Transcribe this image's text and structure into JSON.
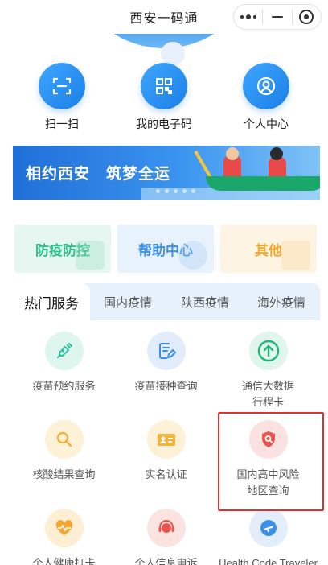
{
  "window": {
    "title": "西安一码通"
  },
  "header": {
    "colors": {
      "primary": "#2f7de1"
    }
  },
  "quick_actions": [
    {
      "label": "扫一扫",
      "icon": "scan-icon"
    },
    {
      "label": "我的电子码",
      "icon": "qrcode-icon"
    },
    {
      "label": "个人中心",
      "icon": "user-icon"
    }
  ],
  "banner": {
    "text": "相约西安　筑梦全运"
  },
  "categories": [
    {
      "label": "防疫防控",
      "color": "#2fbf8c"
    },
    {
      "label": "帮助中心",
      "color": "#3d8fe8"
    },
    {
      "label": "其他",
      "color": "#f2a92a"
    }
  ],
  "tabs": [
    {
      "label": "热门服务",
      "active": true
    },
    {
      "label": "国内疫情"
    },
    {
      "label": "陕西疫情"
    },
    {
      "label": "海外疫情"
    }
  ],
  "services": [
    {
      "line1": "疫苗预约服务",
      "line2": "",
      "icon": "syringe-icon",
      "color": "#2fc4a0"
    },
    {
      "line1": "疫苗接种查询",
      "line2": "",
      "icon": "document-edit-icon",
      "color": "#3d8fe8"
    },
    {
      "line1": "通信大数据",
      "line2": "行程卡",
      "icon": "arrow-up-circle-icon",
      "color": "#20b57a"
    },
    {
      "line1": "核酸结果查询",
      "line2": "",
      "icon": "magnifier-icon",
      "color": "#f3b23a"
    },
    {
      "line1": "实名认证",
      "line2": "",
      "icon": "id-card-icon",
      "color": "#f3b23a"
    },
    {
      "line1": "国内高中风险",
      "line2": "地区查询",
      "icon": "shield-search-icon",
      "color": "#e8554e"
    },
    {
      "line1": "个人健康打卡",
      "line2": "",
      "icon": "heart-pulse-icon",
      "color": "#f3a530"
    },
    {
      "line1": "个人信息申诉",
      "line2": "",
      "icon": "customer-service-icon",
      "color": "#e8554e"
    },
    {
      "line1": "Health Code Traveler",
      "line2": "",
      "icon": "airplane-icon",
      "color": "#3d8fe8"
    }
  ]
}
